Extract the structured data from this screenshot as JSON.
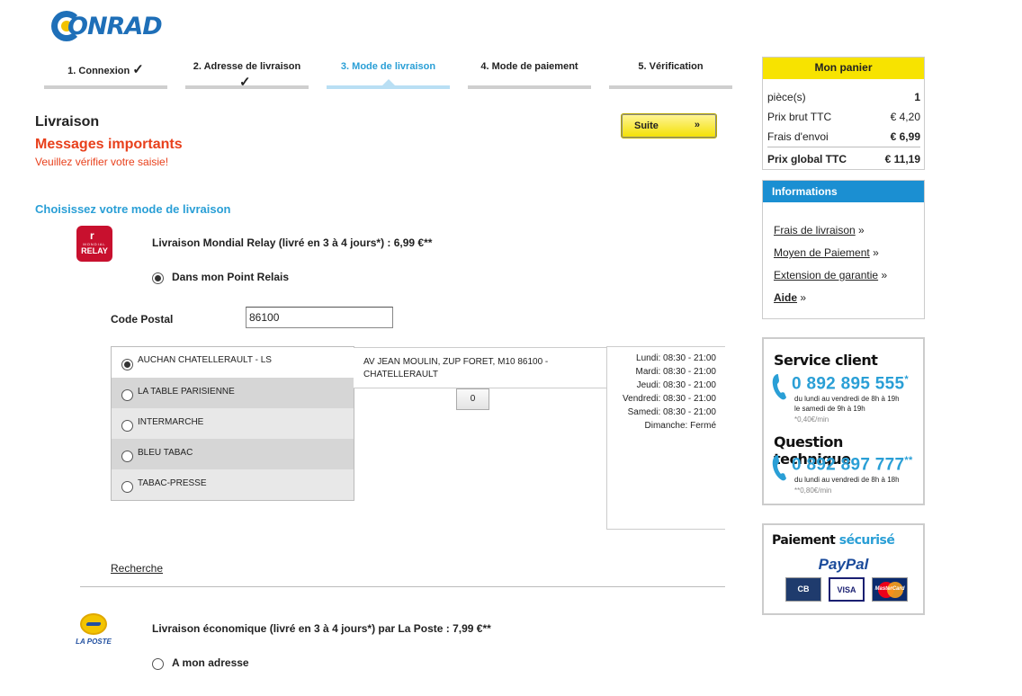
{
  "brand": {
    "logo_text": "ONRAD",
    "primary_color": "#1e6fb8",
    "accent_color": "#f2c200"
  },
  "steps": [
    {
      "label": "1. Connexion",
      "done": true
    },
    {
      "label": "2. Adresse de livraison",
      "done": true
    },
    {
      "label": "3. Mode de livraison",
      "active": true
    },
    {
      "label": "4. Mode de paiement"
    },
    {
      "label": "5. Vérification"
    }
  ],
  "check_mark": "✓",
  "main": {
    "section_title": "Livraison",
    "important_title": "Messages importants",
    "warning": "Veuillez vérifier votre saisie!",
    "suite_label": "Suite",
    "suite_arrow": "»",
    "choose_title": "Choisissez votre mode de livraison"
  },
  "mondial_relay": {
    "logo_r": "r",
    "logo_small": "MONDIAL",
    "logo_big": "RELAY",
    "title": "Livraison Mondial Relay (livré en 3 à 4 jours*) : 6,99 €**",
    "option_label": "Dans mon Point Relais",
    "postal_label": "Code Postal",
    "postal_value": "86100",
    "relays": [
      {
        "name": "AUCHAN CHATELLERAULT - LS",
        "selected": true
      },
      {
        "name": "LA TABLE PARISIENNE"
      },
      {
        "name": "INTERMARCHE"
      },
      {
        "name": "BLEU TABAC"
      },
      {
        "name": "TABAC-PRESSE"
      }
    ],
    "address": "AV JEAN MOULIN, ZUP FORET, M10 86100 - CHATELLERAULT",
    "distance_value": "0",
    "hours": [
      "Lundi: 08:30 - 21:00",
      "Mardi: 08:30 - 21:00",
      "Jeudi: 08:30 - 21:00",
      "Vendredi: 08:30 - 21:00",
      "Samedi: 08:30 - 21:00",
      "Dimanche: Fermé"
    ],
    "search_link": "Recherche"
  },
  "la_poste": {
    "logo_text": "LA POSTE",
    "title": "Livraison économique (livré en 3 à 4 jours*) par La Poste : 7,99 €**",
    "option_label": "A mon adresse"
  },
  "cart": {
    "title": "Mon panier",
    "rows": [
      {
        "label": "pièce(s)",
        "value": "1"
      },
      {
        "label": "Prix brut TTC",
        "value": "€ 4,20"
      },
      {
        "label": "Frais d'envoi",
        "value": "€ 6,99"
      }
    ],
    "total_label": "Prix global TTC",
    "total_value": "€ 11,19"
  },
  "informations": {
    "title": "Informations",
    "links": [
      "Frais de livraison",
      "Moyen de Paiement",
      "Extension de garantie",
      "Aide"
    ],
    "arrow": "»"
  },
  "service": {
    "client_title": "Service client",
    "client_number": "0 892 895 555",
    "client_star": "*",
    "client_hours_1": "du lundi au vendredi de 8h à 19h",
    "client_hours_2": "le samedi de 9h à 19h",
    "client_price": "*0,40€/min",
    "tech_title": "Question technique",
    "tech_number": "0 892 897 777",
    "tech_star": "**",
    "tech_hours": "du lundi au vendredi de 8h à 18h",
    "tech_price": "**0,80€/min"
  },
  "payment": {
    "title_1": "Paiement",
    "title_2": "sécurisé",
    "paypal": "PayPal",
    "card_cb": "CB",
    "card_visa": "VISA",
    "card_mc": "MasterCard"
  }
}
